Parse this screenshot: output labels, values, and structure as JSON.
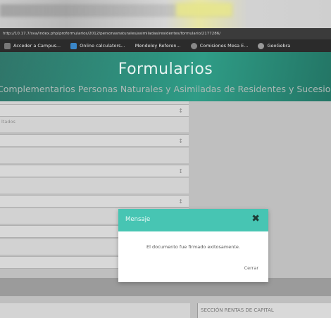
{
  "browser": {
    "url": "http://10.17.7/sva/index.php/proformularios/2012/personasnaturales/asimiladas/residentes/formulario/2177286/",
    "bookmarks": [
      {
        "label": "Acceder a Campus...",
        "icon": "campus-icon",
        "color": "#777777"
      },
      {
        "label": "Online calculators...",
        "icon": "calculator-icon",
        "color": "#3a86c8"
      },
      {
        "label": "Mendeley Referen...",
        "icon": "mendeley-icon",
        "color": "#444444"
      },
      {
        "label": "Comisiones Mesa E...",
        "icon": "globe-icon",
        "color": "#888888"
      },
      {
        "label": "GeoGebra",
        "icon": "geogebra-icon",
        "color": "#999999"
      }
    ]
  },
  "header": {
    "title": "Formularios",
    "subtitle": "Complementarios Personas Naturales y Asimiladas de Residentes y Sucesiones"
  },
  "form": {
    "field_label_1": "",
    "field_label_2": "ltados",
    "caret": "↕",
    "section_label": "SECCIÓN RENTAS DE CAPITAL"
  },
  "modal": {
    "title": "Mensaje",
    "close_glyph": "✖",
    "message": "El documento fue firmado exitosamente.",
    "button_label": "Cerrar"
  },
  "colors": {
    "header_teal": "#2b8a78",
    "modal_header": "#47c5b3"
  }
}
